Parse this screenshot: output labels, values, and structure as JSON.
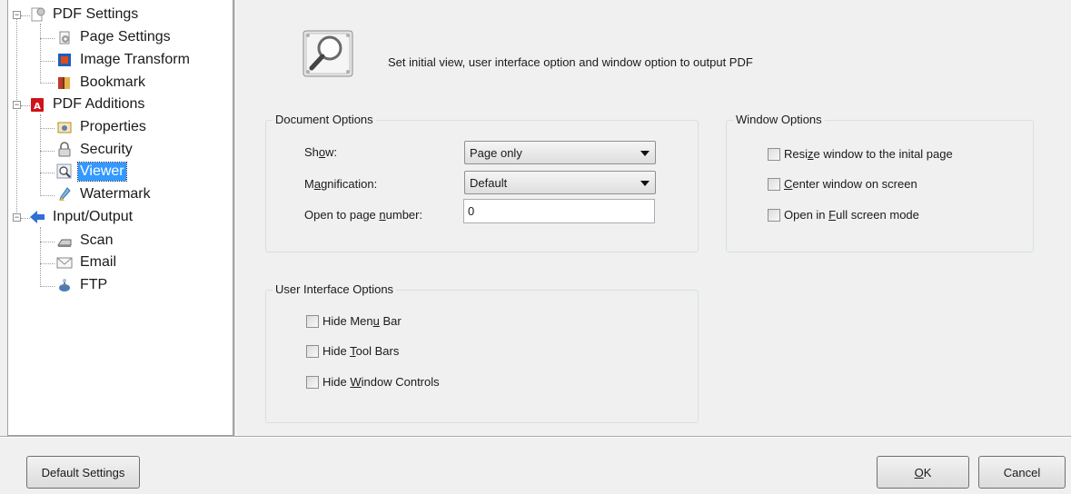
{
  "tree": {
    "pdf_settings": "PDF Settings",
    "page_settings": "Page Settings",
    "image_transform": "Image Transform",
    "bookmark": "Bookmark",
    "pdf_additions": "PDF Additions",
    "properties": "Properties",
    "security": "Security",
    "viewer": "Viewer",
    "watermark": "Watermark",
    "input_output": "Input/Output",
    "scan": "Scan",
    "email": "Email",
    "ftp": "FTP",
    "selected": "Viewer"
  },
  "header": {
    "description": "Set initial view, user interface option and window option to output PDF",
    "icon": "magnifier-viewer-icon"
  },
  "document_options": {
    "title": "Document Options",
    "show_label": [
      "Sh",
      "o",
      "w:"
    ],
    "show_value": "Page only",
    "magnification_label": [
      "M",
      "a",
      "gnification:"
    ],
    "magnification_value": "Default",
    "open_page_label": [
      "Open to page ",
      "n",
      "umber:"
    ],
    "open_page_value": "0"
  },
  "window_options": {
    "title": "Window Options",
    "resize": [
      "Resi",
      "z",
      "e window to the inital page"
    ],
    "center": [
      "",
      "C",
      "enter window on screen"
    ],
    "fullscreen": [
      "Open in ",
      "F",
      "ull screen mode"
    ]
  },
  "ui_options": {
    "title": "User Interface Options",
    "hide_menu": [
      "Hide Men",
      "u",
      " Bar"
    ],
    "hide_tool": [
      "Hide ",
      "T",
      "ool Bars"
    ],
    "hide_window": [
      "Hide ",
      "W",
      "indow Controls"
    ]
  },
  "buttons": {
    "default_settings": "Default Settings",
    "ok": [
      "",
      "O",
      "K"
    ],
    "cancel": "Cancel"
  }
}
